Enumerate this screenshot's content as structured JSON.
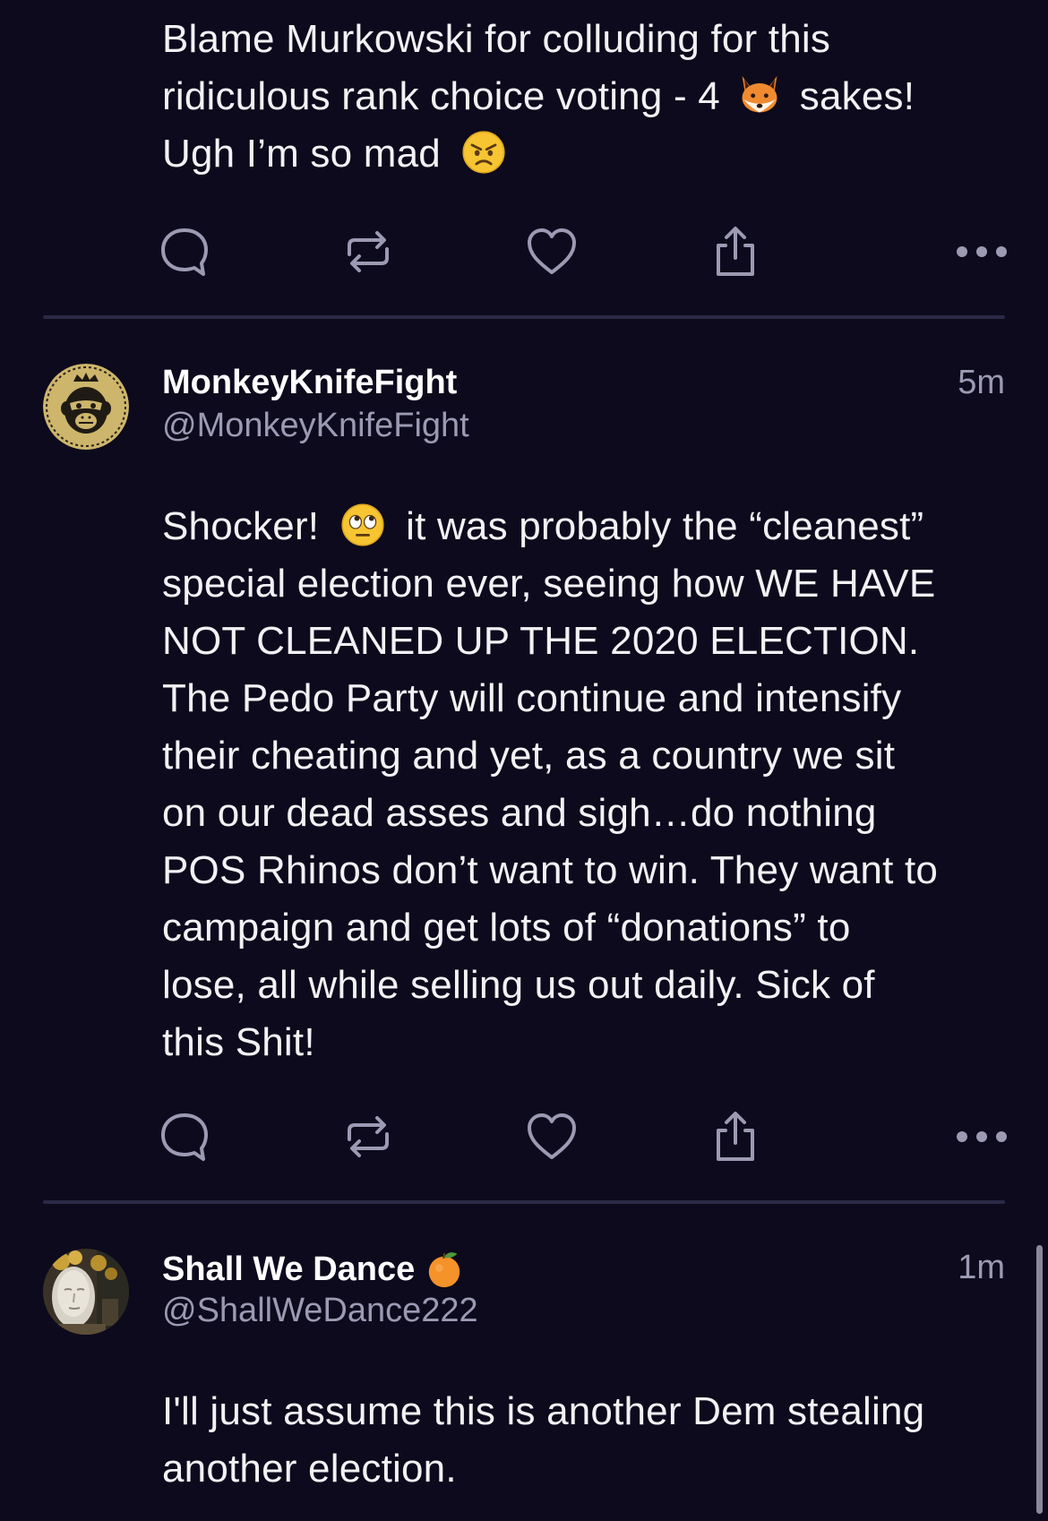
{
  "colors": {
    "background": "#0c0a1c",
    "text_primary": "#f2f2f5",
    "text_secondary": "#9c9ab3",
    "icon": "#9c9ab3",
    "divider": "#2b2947"
  },
  "posts": [
    {
      "lines": [
        "Blame Murkowski for colluding for this",
        "ridiculous rank choice voting - 4",
        "sakes!",
        "Ugh I’m so mad"
      ],
      "emojis": [
        "fox-emoji",
        "angry-face-emoji"
      ],
      "actions": [
        "reply-icon",
        "repost-icon",
        "like-icon",
        "share-icon",
        "more-icon"
      ]
    },
    {
      "display_name": "MonkeyKnifeFight",
      "handle": "@MonkeyKnifeFight",
      "time": "5m",
      "avatar": "monkey-crown-logo",
      "lines": [
        "Shocker!",
        "it was probably the “cleanest”",
        "special election ever, seeing how WE HAVE",
        "NOT CLEANED UP THE 2020 ELECTION.",
        "The Pedo Party will continue and intensify",
        "their cheating and yet, as a country we sit",
        "on our dead asses and sigh…do nothing",
        "POS Rhinos don’t want to win. They want to",
        "campaign and get lots of “donations” to",
        "lose, all while selling us out daily. Sick of",
        "this Shit!"
      ],
      "emojis": [
        "face-with-rolling-eyes-emoji"
      ],
      "actions": [
        "reply-icon",
        "repost-icon",
        "like-icon",
        "share-icon",
        "more-icon"
      ]
    },
    {
      "display_name": "Shall We Dance",
      "handle": "@ShallWeDance222",
      "time": "1m",
      "avatar": "statue-photo",
      "name_emoji": "tangerine-emoji",
      "lines": [
        "I'll just assume this is another Dem stealing",
        "another election."
      ]
    }
  ]
}
